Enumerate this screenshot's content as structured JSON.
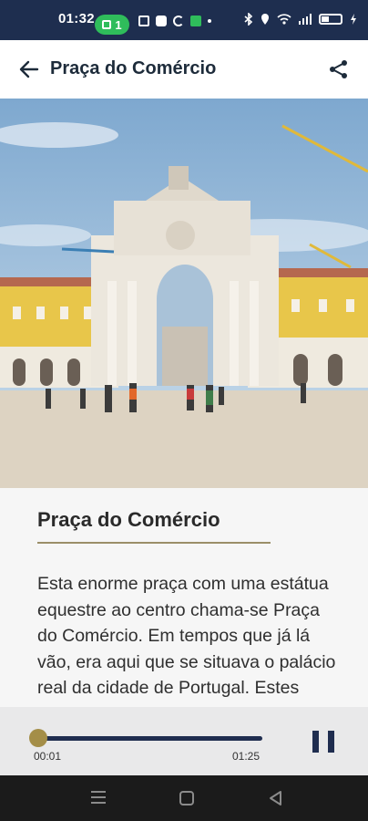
{
  "status_bar": {
    "time": "01:32",
    "notification_count": "1"
  },
  "app_bar": {
    "title": "Praça do Comércio",
    "back_icon": "arrow-left-icon",
    "share_icon": "share-icon"
  },
  "hero": {
    "subject": ""
  },
  "content": {
    "title": "Praça do Comércio",
    "body": "Esta enorme praça com uma estátua equestre ao centro chama-se Praça do Comércio. Em tempos que já lá vão, era aqui que se situava o palácio real da cidade de Portugal. Estes locais"
  },
  "player": {
    "current_time": "00:01",
    "total_time": "01:25",
    "pause_icon": "pause-icon",
    "colors": {
      "track": "#1f2d4f",
      "thumb": "#a48e48"
    }
  },
  "nav_bar": {
    "menu_icon": "menu-icon",
    "home_icon": "home-icon",
    "back_icon": "triangle-back-icon"
  },
  "colors": {
    "status_bar": "#1e2e4f",
    "accent_rule": "#9b8f68",
    "pill": "#2fbd5b"
  }
}
